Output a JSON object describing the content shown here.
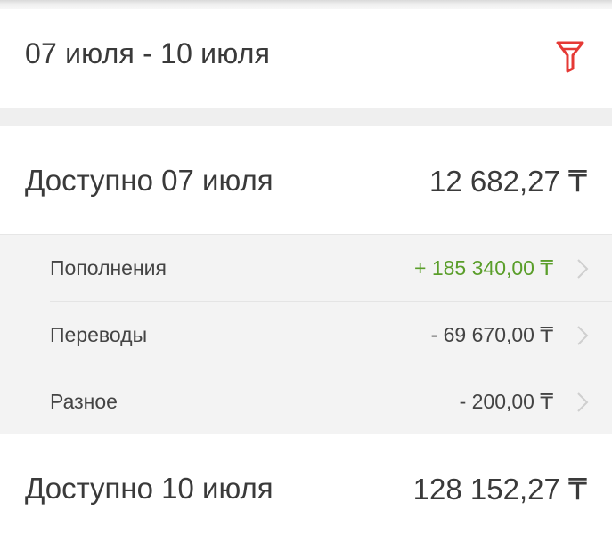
{
  "header": {
    "date_range": "07 июля - 10 июля",
    "filter_icon": "filter-icon",
    "accent_color": "#e53935"
  },
  "balance_start": {
    "label": "Доступно 07 июля",
    "value": "12 682,27 ₸"
  },
  "details": {
    "items": [
      {
        "label": "Пополнения",
        "value": "+ 185 340,00 ₸",
        "color": "#5a9e2a"
      },
      {
        "label": "Переводы",
        "value": "- 69 670,00 ₸",
        "color": "#444444"
      },
      {
        "label": "Разное",
        "value": "- 200,00 ₸",
        "color": "#444444"
      }
    ],
    "chevron_icon": "chevron-right-icon"
  },
  "balance_end": {
    "label": "Доступно 10 июля",
    "value": "128 152,27 ₸"
  }
}
